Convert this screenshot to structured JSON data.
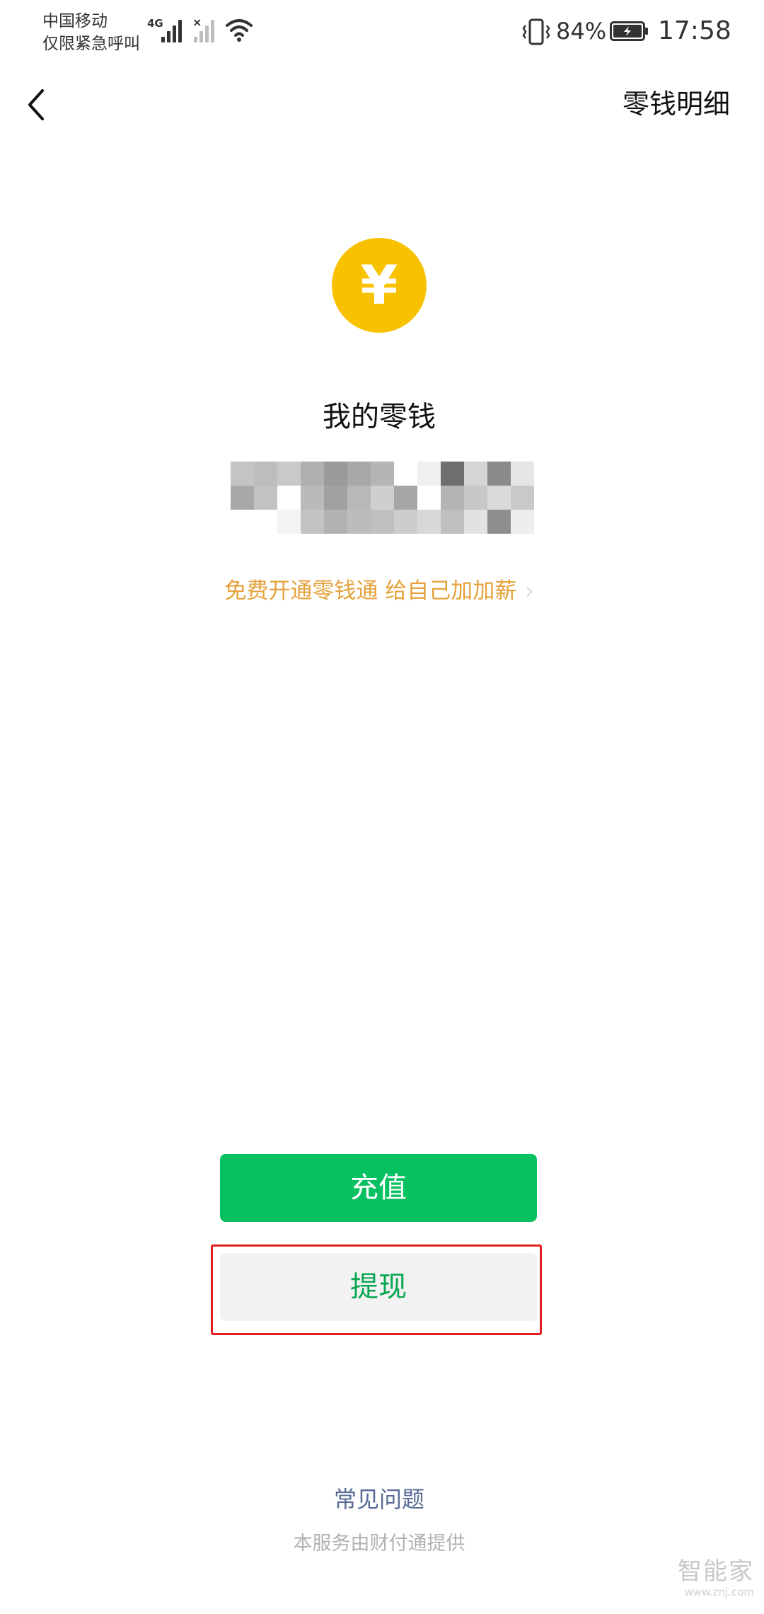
{
  "status_bar": {
    "carrier_line1": "中国移动",
    "carrier_line2": "仅限紧急呼叫",
    "network_type": "4G",
    "battery_percent": "84%",
    "time": "17:58"
  },
  "nav": {
    "back_icon": "chevron-left-icon",
    "detail_label": "零钱明细"
  },
  "balance": {
    "coin_icon": "yuan-coin-icon",
    "coin_glyph": "¥",
    "title": "我的零钱",
    "amount_hidden": true
  },
  "promo": {
    "text": "免费开通零钱通 给自己加加薪",
    "chevron": "›"
  },
  "buttons": {
    "recharge_label": "充值",
    "withdraw_label": "提现"
  },
  "footer": {
    "faq_label": "常见问题",
    "provider_text": "本服务由财付通提供"
  },
  "watermark": {
    "main": "智能家",
    "sub": "www.znj.com"
  },
  "colors": {
    "accent_green": "#07c160",
    "coin_yellow": "#f9c200",
    "promo_orange": "#e6a23c",
    "link_blue": "#576b95",
    "highlight_red": "#e02020"
  }
}
